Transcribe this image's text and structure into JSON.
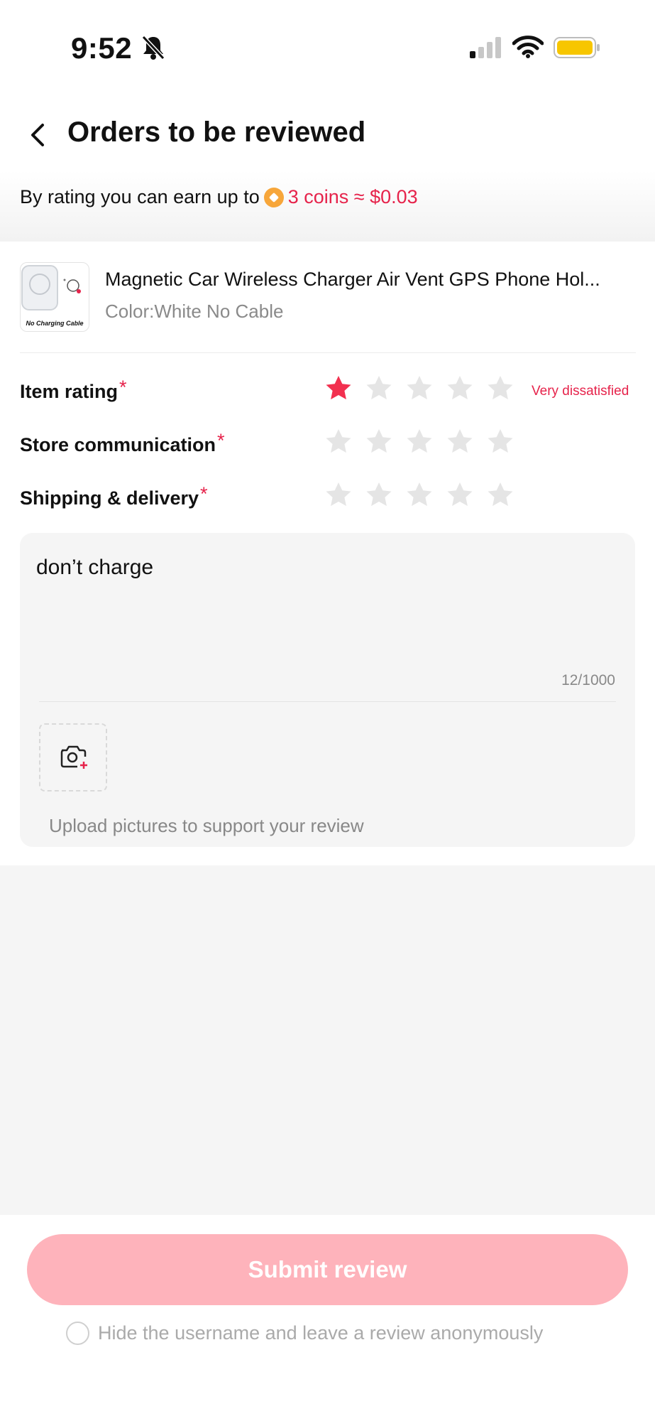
{
  "status_bar": {
    "time": "9:52"
  },
  "header": {
    "title": "Orders to be reviewed"
  },
  "banner": {
    "prefix": "By rating you can earn up to",
    "reward": "3 coins ≈ $0.03"
  },
  "product": {
    "title": "Magnetic Car Wireless Charger Air Vent GPS Phone Hol...",
    "variant": "Color:White No Cable",
    "image_caption": "No Charging Cable"
  },
  "ratings": [
    {
      "label": "Item rating",
      "stars": 1,
      "note": "Very dissatisfied"
    },
    {
      "label": "Store communication",
      "stars": 0,
      "note": ""
    },
    {
      "label": "Shipping & delivery",
      "stars": 0,
      "note": ""
    }
  ],
  "required_mark": "*",
  "review": {
    "text": "don’t charge",
    "counter": "12/1000",
    "upload_hint": "Upload pictures to support your review"
  },
  "footer": {
    "submit_label": "Submit review",
    "anonymous_label": "Hide the username and leave a review anonymously"
  },
  "colors": {
    "accent": "#e6234b",
    "star_active": "#f2304f",
    "star_inactive": "#e5e5e5",
    "submit_disabled": "#feb3bb",
    "battery": "#f7c600"
  }
}
